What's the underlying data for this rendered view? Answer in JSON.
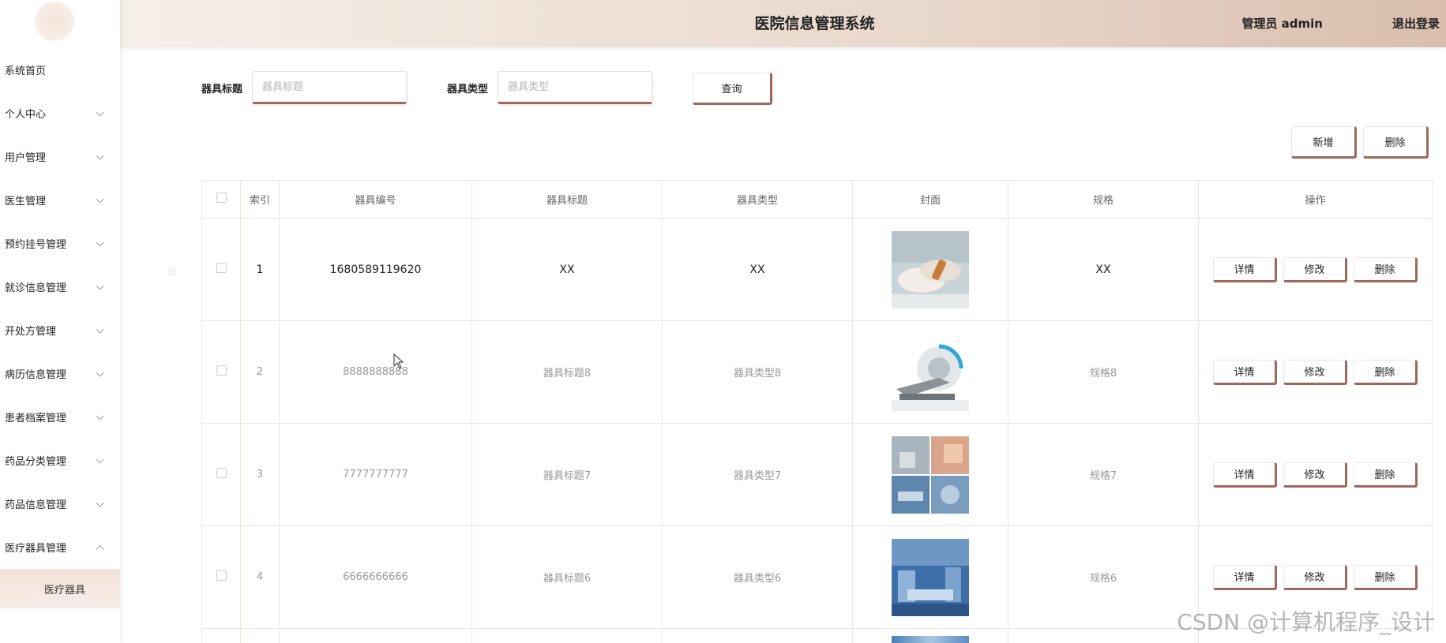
{
  "header": {
    "title": "医院信息管理系统",
    "user": "管理员 admin",
    "logout": "退出登录"
  },
  "sidebar": {
    "items": [
      {
        "label": "系统首页"
      },
      {
        "label": "个人中心"
      },
      {
        "label": "用户管理"
      },
      {
        "label": "医生管理"
      },
      {
        "label": "预约挂号管理"
      },
      {
        "label": "就诊信息管理"
      },
      {
        "label": "开处方管理"
      },
      {
        "label": "病历信息管理"
      },
      {
        "label": "患者档案管理"
      },
      {
        "label": "药品分类管理"
      },
      {
        "label": "药品信息管理"
      },
      {
        "label": "医疗器具管理"
      }
    ],
    "sub_item": "医疗器具"
  },
  "search": {
    "title_label": "器具标题",
    "title_placeholder": "器具标题",
    "type_label": "器具类型",
    "type_placeholder": "器具类型",
    "query_button": "查询"
  },
  "actions": {
    "add": "新增",
    "delete": "删除"
  },
  "table": {
    "headers": [
      "索引",
      "器具编号",
      "器具标题",
      "器具类型",
      "封面",
      "规格",
      "操作"
    ],
    "rows": [
      {
        "index": "1",
        "code": "1680589119620",
        "title": "XX",
        "type": "XX",
        "spec": "XX"
      },
      {
        "index": "2",
        "code": "8888888888",
        "title": "器具标题8",
        "type": "器具类型8",
        "spec": "规格8"
      },
      {
        "index": "3",
        "code": "7777777777",
        "title": "器具标题7",
        "type": "器具类型7",
        "spec": "规格7"
      },
      {
        "index": "4",
        "code": "6666666666",
        "title": "器具标题6",
        "type": "器具类型6",
        "spec": "规格6"
      }
    ],
    "row_actions": {
      "detail": "详情",
      "edit": "修改",
      "delete": "删除"
    }
  },
  "watermark": "CSDN @计算机程序_设计"
}
